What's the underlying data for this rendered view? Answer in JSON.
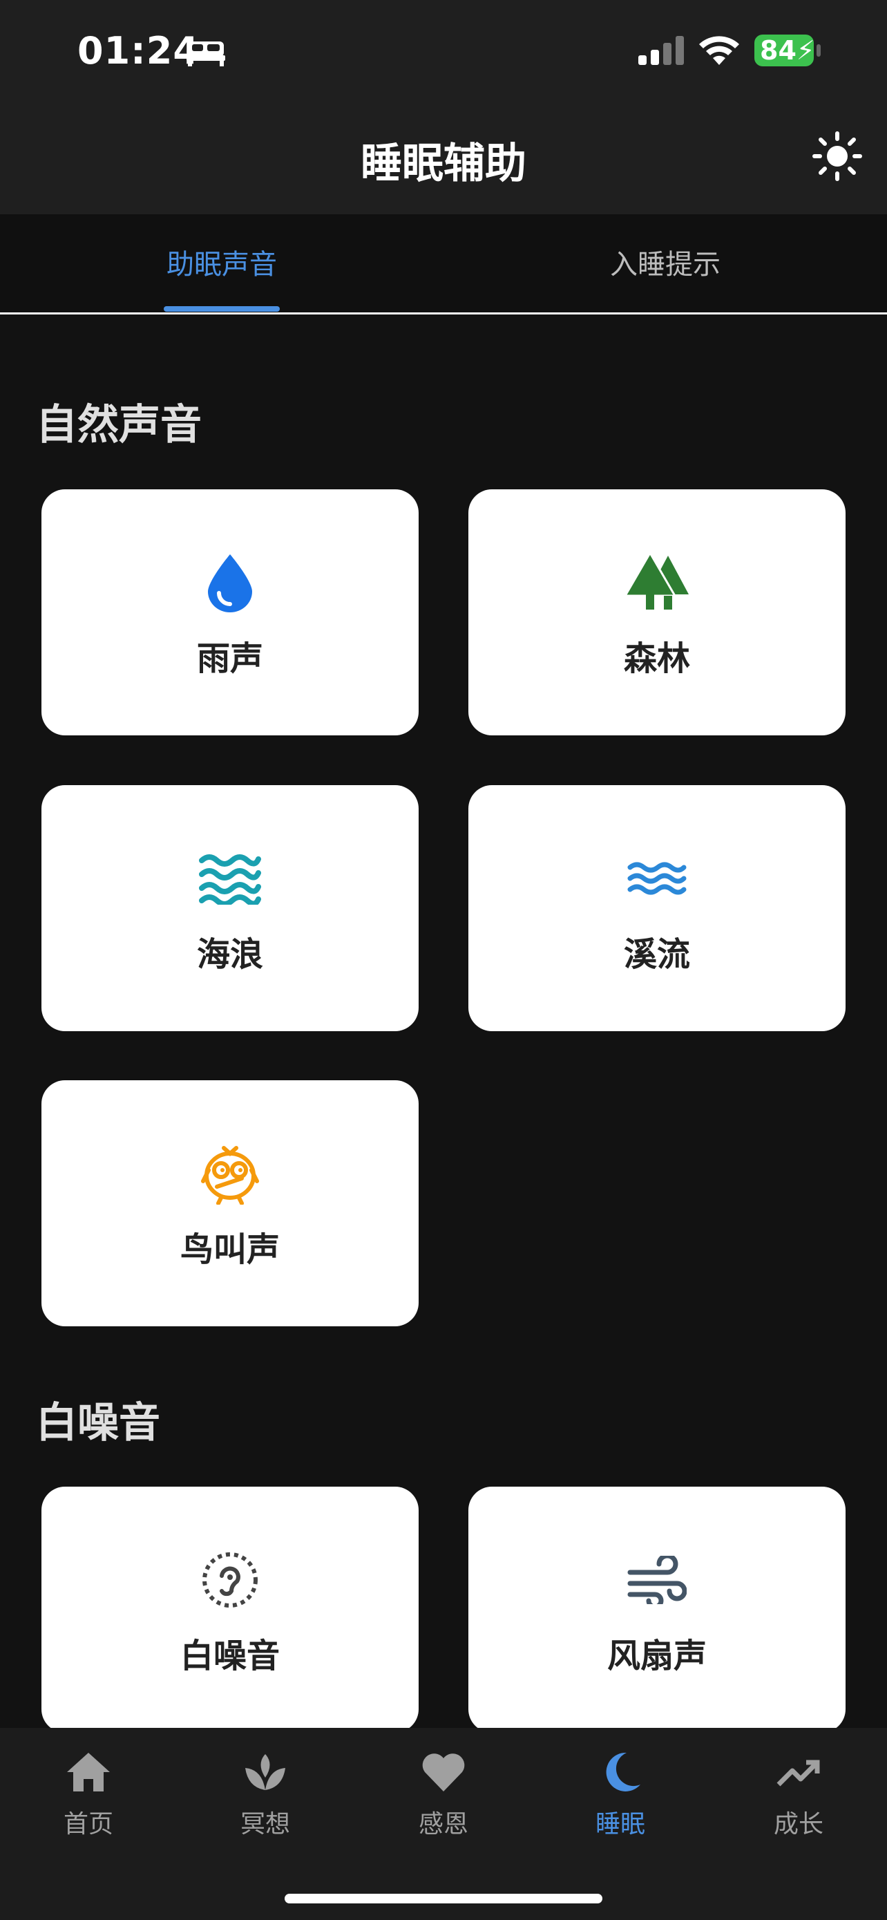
{
  "status": {
    "time": "01:24",
    "battery": "84"
  },
  "appbar": {
    "title": "睡眠辅助"
  },
  "tabs": [
    {
      "label": "助眠声音"
    },
    {
      "label": "入睡提示"
    }
  ],
  "sections": [
    {
      "title": "自然声音",
      "items": [
        {
          "label": "雨声",
          "icon": "water-drop-icon",
          "color": "#1a73e8"
        },
        {
          "label": "森林",
          "icon": "forest-icon",
          "color": "#2e7d32"
        },
        {
          "label": "海浪",
          "icon": "waves-icon",
          "color": "#1aa0b0"
        },
        {
          "label": "溪流",
          "icon": "stream-icon",
          "color": "#2b88d8"
        },
        {
          "label": "鸟叫声",
          "icon": "bird-icon",
          "color": "#f59a0c"
        }
      ]
    },
    {
      "title": "白噪音",
      "items": [
        {
          "label": "白噪音",
          "icon": "noise-ear-icon",
          "color": "#444444"
        },
        {
          "label": "风扇声",
          "icon": "wind-icon",
          "color": "#445566"
        }
      ]
    }
  ],
  "bottom_nav": [
    {
      "label": "首页",
      "icon": "home-icon"
    },
    {
      "label": "冥想",
      "icon": "lotus-icon"
    },
    {
      "label": "感恩",
      "icon": "heart-icon"
    },
    {
      "label": "睡眠",
      "icon": "moon-icon",
      "active": true
    },
    {
      "label": "成长",
      "icon": "trending-up-icon"
    }
  ],
  "colors": {
    "accent": "#4a90e2",
    "background": "#121212",
    "card": "#ffffff"
  }
}
